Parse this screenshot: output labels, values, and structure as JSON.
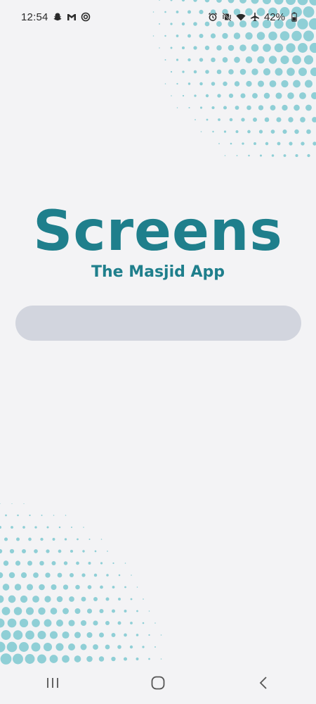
{
  "status_bar": {
    "time": "12:54",
    "battery": "42%",
    "left_icons": [
      "snapchat-icon",
      "gmail-icon",
      "target-icon"
    ],
    "right_icons": [
      "alarm-icon",
      "vibrate-mute-icon",
      "wifi-icon",
      "airplane-icon",
      "battery-icon"
    ]
  },
  "brand": {
    "title": "Screens",
    "subtitle": "The Masjid App"
  },
  "loading": {
    "progress": 0
  },
  "nav_bar": {
    "buttons": [
      "recents-icon",
      "home-icon",
      "back-icon"
    ]
  },
  "colors": {
    "background": "#f3f3f5",
    "brand": "#1f7f8c",
    "dots": "#8fcfd6",
    "loading_track": "#d2d5de"
  }
}
